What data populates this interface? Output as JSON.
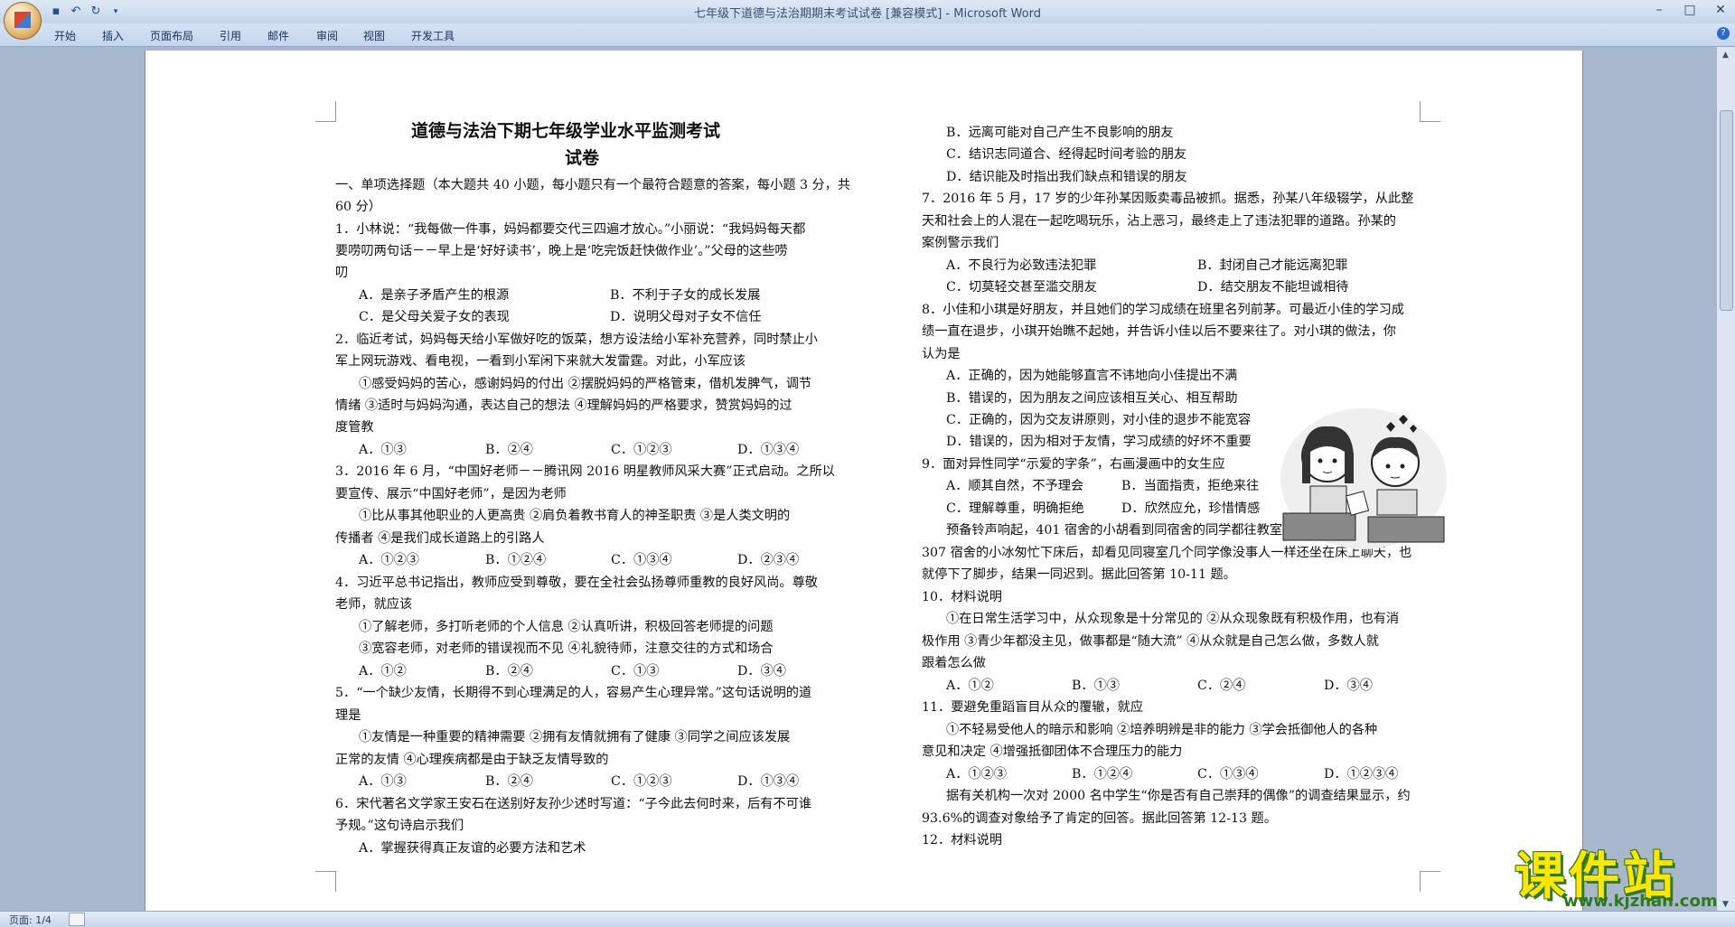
{
  "window": {
    "title": "七年级下道德与法治期期末考试试卷 [兼容模式] - Microsoft Word",
    "controls": [
      "–",
      "□",
      "✕"
    ]
  },
  "quick_access": [
    "save-icon",
    "undo-icon",
    "redo-icon",
    "customize-icon"
  ],
  "ribbon_tabs": [
    "开始",
    "插入",
    "页面布局",
    "引用",
    "邮件",
    "审阅",
    "视图",
    "开发工具"
  ],
  "status": {
    "page": "页面: 1/4"
  },
  "watermark": {
    "text": "课件站",
    "url": "www.kjzhan.com"
  },
  "left_column": [
    "道德与法治下期七年级学业水平监测考试",
    "试卷",
    "一、单项选择题（本大题共 40 小题，每小题只有一个最符合题意的答案，每小题 3 分，共",
    "60 分）",
    "1．小林说：“我每做一件事，妈妈都要交代三四遍才放心。”小丽说：“我妈妈每天都",
    "要唠叨两句话－－早上是‘好好读书’，晚上是‘吃完饭赶快做作业’。”父母的这些唠",
    "叨",
    "A．是亲子矛盾产生的根源",
    "B．不利于子女的成长发展",
    "C．是父母关爱子女的表现",
    "D．说明父母对子女不信任",
    "2．临近考试，妈妈每天给小军做好吃的饭菜，想方设法给小军补充营养，同时禁止小",
    "军上网玩游戏、看电视，一看到小军闲下来就大发雷霆。对此，小军应该",
    "①感受妈妈的苦心，感谢妈妈的付出  ②摆脱妈妈的严格管束，借机发脾气，调节",
    "情绪  ③适时与妈妈沟通，表达自己的想法  ④理解妈妈的严格要求，赞赏妈妈的过",
    "度管教",
    "A．①③",
    "B．②④",
    "C．①②③",
    "D．①③④",
    "3．2016 年 6 月，“中国好老师－－腾讯网 2016 明星教师风采大赛”正式启动。之所以",
    "要宣传、展示“中国好老师”，是因为老师",
    "①比从事其他职业的人更高贵  ②肩负着教书育人的神圣职责  ③是人类文明的",
    "传播者 ④是我们成长道路上的引路人",
    "A．①②③",
    "B．①②④",
    "C．①③④",
    "D．②③④",
    "4．习近平总书记指出，教师应受到尊敬，要在全社会弘扬尊师重教的良好风尚。尊敬",
    "老师，就应该",
    "①了解老师，多打听老师的个人信息  ②认真听讲，积极回答老师提的问题",
    "③宽容老师，对老师的错误视而不见  ④礼貌待师，注意交往的方式和场合",
    "A．①②",
    "B．②④",
    "C．①③",
    "D．③④",
    "5．“一个缺少友情，长期得不到心理满足的人，容易产生心理异常。”这句话说明的道",
    "理是",
    "①友情是一种重要的精神需要  ②拥有友情就拥有了健康  ③同学之间应该发展",
    "正常的友情  ④心理疾病都是由于缺乏友情导致的",
    "A．①③",
    "B．②④",
    "C．①②③",
    "D．①③④",
    "6．宋代著名文学家王安石在送别好友孙少述时写道：“子今此去何时来，后有不可谁",
    "予规。”这句诗启示我们",
    "A．掌握获得真正友谊的必要方法和艺术"
  ],
  "right_column": [
    "B．远离可能对自己产生不良影响的朋友",
    "C．结识志同道合、经得起时间考验的朋友",
    "D．结识能及时指出我们缺点和错误的朋友",
    "7．2016 年 5 月，17 岁的少年孙某因贩卖毒品被抓。据悉，孙某八年级辍学，从此整",
    "天和社会上的人混在一起吃喝玩乐，沾上恶习，最终走上了违法犯罪的道路。孙某的",
    "案例警示我们",
    "A．不良行为必致违法犯罪",
    "B．封闭自己才能远离犯罪",
    "C．切莫轻交甚至滥交朋友",
    "D．结交朋友不能坦诚相待",
    "8．小佳和小琪是好朋友，并且她们的学习成绩在班里名列前茅。可最近小佳的学习成",
    "绩一直在退步，小琪开始瞧不起她，并告诉小佳以后不要来往了。对小琪的做法，你",
    "认为是",
    "A．正确的，因为她能够直言不讳地向小佳提出不满",
    "B．错误的，因为朋友之间应该相互关心、相互帮助",
    "C．正确的，因为交友讲原则，对小佳的退步不能宽容",
    "D．错误的，因为相对于友情，学习成绩的好坏不重要",
    "9．面对异性同学“示爱的字条”，右画漫画中的女生应",
    "A．顺其自然，不予理会",
    "B．当面指责，拒绝来往",
    "C．理解尊重，明确拒绝",
    "D．欣然应允，珍惜情感",
    "预备铃声响起，401 宿舍的小胡看到同宿舍的同学都往教室赶，也赶紧向教室走去。",
    "307 宿舍的小冰匆忙下床后，却看见同寝室几个同学像没事人一样还坐在床上聊天，也",
    "就停下了脚步，结果一同迟到。据此回答第 10-11 题。",
    "10．材料说明",
    "①在日常生活学习中，从众现象是十分常见的  ②从众现象既有积极作用，也有消",
    "极作用  ③青少年都没主见，做事都是“随大流”  ④从众就是自己怎么做，多数人就",
    "跟着怎么做",
    "A．①②",
    "B．①③",
    "C．②④",
    "D．③④",
    "11．要避免重蹈盲目从众的覆辙，就应",
    "①不轻易受他人的暗示和影响  ②培养明辨是非的能力  ③学会抵御他人的各种",
    "意见和决定  ④增强抵御团体不合理压力的能力",
    "A．①②③",
    "B．①②④",
    "C．①③④",
    "D．①②③④",
    "据有关机构一次对 2000 名中学生“你是否有自己崇拜的偶像”的调查结果显示，约",
    "93.6%的调查对象给予了肯定的回答。据此回答第 12-13 题。",
    "12．材料说明"
  ]
}
